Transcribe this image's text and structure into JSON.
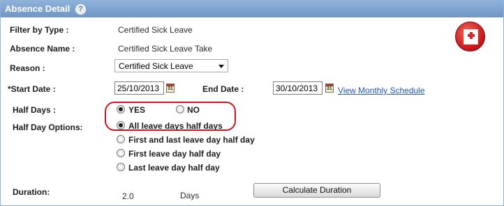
{
  "header": {
    "title": "Absence Detail",
    "help_icon": "question-icon"
  },
  "filter_by_type": {
    "label": "Filter by Type :",
    "value": "Certified Sick Leave"
  },
  "absence_name": {
    "label": "Absence Name :",
    "value": "Certified Sick Leave Take"
  },
  "reason": {
    "label": "Reason :",
    "value": "Certified Sick Leave"
  },
  "start_date": {
    "label": "*Start Date :",
    "value": "25/10/2013",
    "calendar_icon_text": "31"
  },
  "end_date": {
    "label": "End Date :",
    "value": "30/10/2013",
    "calendar_icon_text": "31"
  },
  "view_monthly_schedule": "View Monthly Schedule",
  "half_days": {
    "label": "Half Days :",
    "options": [
      {
        "label": "YES",
        "checked": true
      },
      {
        "label": "NO",
        "checked": false
      }
    ]
  },
  "half_day_options": {
    "label": "Half Day Options:",
    "options": [
      {
        "label": "All leave days half days",
        "checked": true
      },
      {
        "label": "First and last leave day half day",
        "checked": false
      },
      {
        "label": "First leave day half day",
        "checked": false
      },
      {
        "label": "Last leave day half day",
        "checked": false
      }
    ]
  },
  "duration": {
    "label": "Duration:",
    "value": "2.0",
    "unit": "Days"
  },
  "calculate_button": "Calculate Duration",
  "colors": {
    "header": "#7ea3ce",
    "highlight": "#d4111b",
    "link": "#2457a8"
  }
}
